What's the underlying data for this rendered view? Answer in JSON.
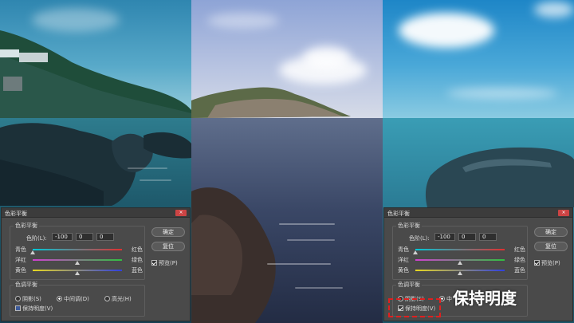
{
  "dialogs": {
    "left": {
      "title": "色彩平衡",
      "close_symbol": "×",
      "balance_group_label": "色彩平衡",
      "levels_label": "色阶(L):",
      "levels": [
        "-100",
        "0",
        "0"
      ],
      "sliders": [
        {
          "left": "青色",
          "right": "红色",
          "value": -100
        },
        {
          "left": "洋红",
          "right": "绿色",
          "value": 0
        },
        {
          "left": "黄色",
          "right": "蓝色",
          "value": 0
        }
      ],
      "tone_group_label": "色调平衡",
      "tones": [
        "阴影(S)",
        "中间调(D)",
        "高光(H)"
      ],
      "selected_tone": "中间调(D)",
      "preserve_label": "保持明度(V)",
      "preserve_checked": false,
      "ok_label": "确定",
      "reset_label": "复位",
      "preview_label": "预览(P)",
      "preview_checked": true
    },
    "right": {
      "title": "色彩平衡",
      "close_symbol": "×",
      "balance_group_label": "色彩平衡",
      "levels_label": "色阶(L):",
      "levels": [
        "-100",
        "0",
        "0"
      ],
      "sliders": [
        {
          "left": "青色",
          "right": "红色",
          "value": -100
        },
        {
          "left": "洋红",
          "right": "绿色",
          "value": 0
        },
        {
          "left": "黄色",
          "right": "蓝色",
          "value": 0
        }
      ],
      "tone_group_label": "色调平衡",
      "tones": [
        "阴影(S)",
        "中"
      ],
      "selected_tone": "中",
      "preserve_label": "保持明度(V)",
      "preserve_checked": true,
      "ok_label": "确定",
      "reset_label": "复位",
      "preview_label": "预览(P)",
      "preview_checked": true
    }
  },
  "callout_text": "保持明度",
  "colors": {
    "highlight": "#e0201f",
    "dialog_bg": "#4a4a4a"
  }
}
